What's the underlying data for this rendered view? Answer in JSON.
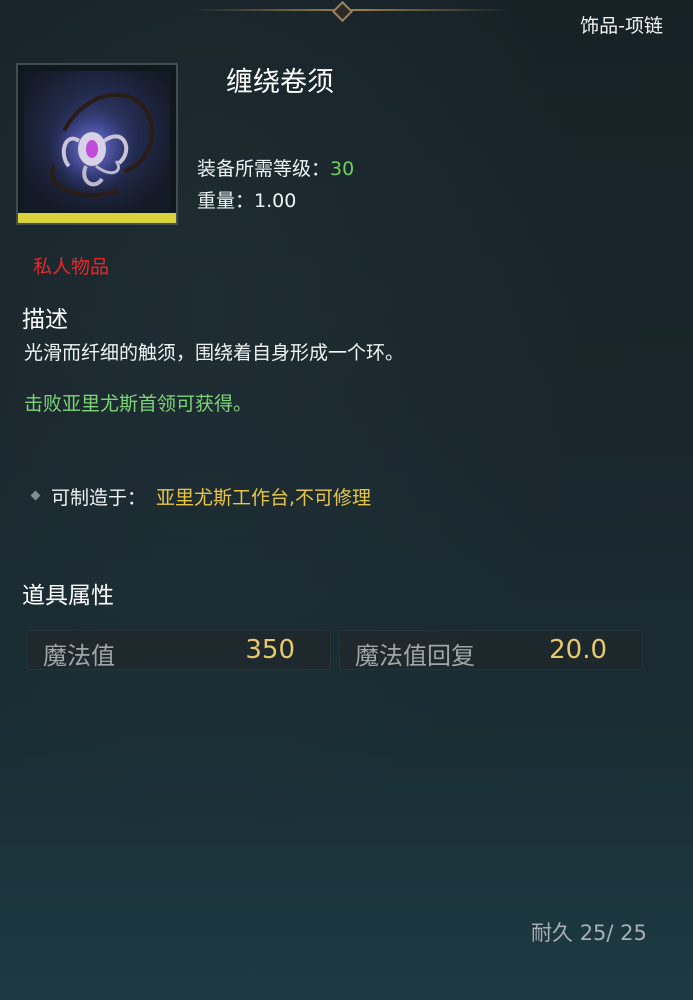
{
  "category": "饰品-项链",
  "item": {
    "name": "缠绕卷须",
    "required_level_label": "装备所需等级：",
    "required_level_value": "30",
    "weight_label": "重量：",
    "weight_value": "1.00",
    "private_label": "私人物品",
    "image_icon": "tentacle-necklace-icon"
  },
  "description": {
    "title": "描述",
    "text": "光滑而纤细的触须，围绕着自身形成一个环。",
    "source": "击败亚里尤斯首领可获得。"
  },
  "crafting": {
    "label": "可制造于：",
    "station": "亚里尤斯工作台,不可修理"
  },
  "properties": {
    "title": "道具属性",
    "items": [
      {
        "name": "魔法值",
        "value": "350"
      },
      {
        "name": "魔法值回复",
        "value": "20.0"
      }
    ]
  },
  "durability": {
    "label": "耐久",
    "current": "25/",
    "max": "25"
  },
  "colors": {
    "level_value": "#6fd05c",
    "private": "#e5272a",
    "source": "#7ed27a",
    "station": "#e7c54a",
    "property_value": "#e6c86e",
    "rarity_bar": "#d9d23a"
  }
}
